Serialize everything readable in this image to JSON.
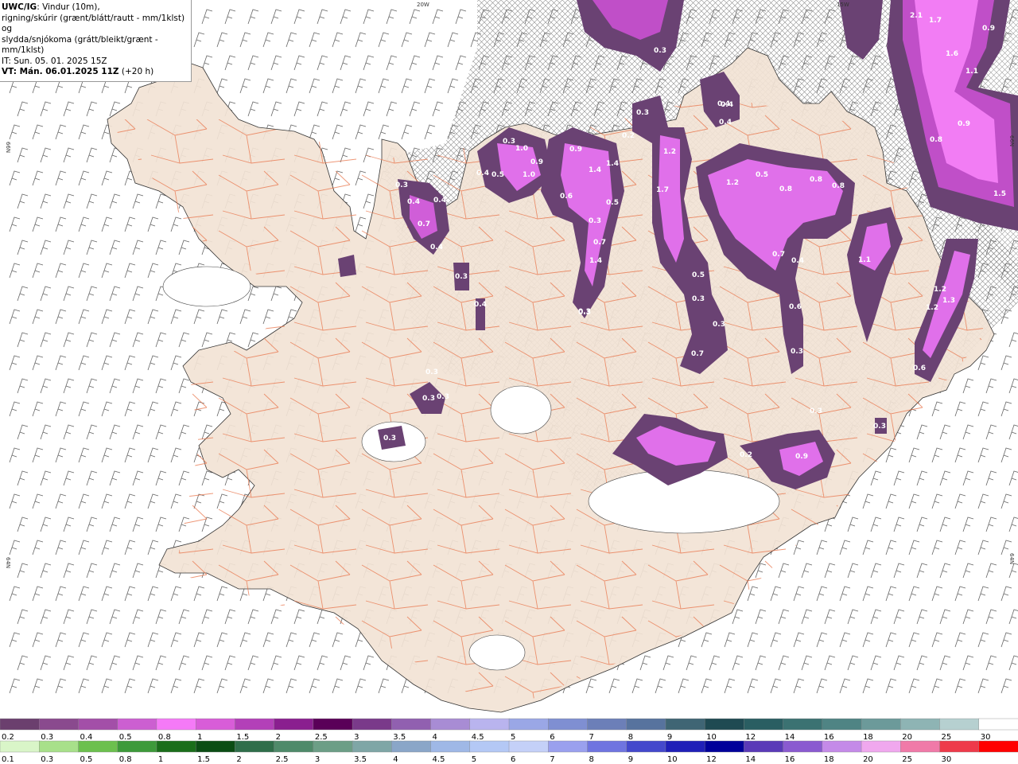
{
  "header": {
    "line1_bold": "UWC/IG",
    "line1_rest": ": Vindur (10m),",
    "line2": "rigning/skúrir (grænt/blátt/rautt - mm/1klst) og",
    "line3": "slydda/snjókoma (grátt/bleikt/grænt - mm/1klst)",
    "line4": "IT: Sun. 05. 01. 2025 15Z",
    "line5_bold": "VT: Mán. 06.01.2025 11Z",
    "line5_rest": " (+20 h)"
  },
  "grid_labels": [
    "20W",
    "15W",
    "66N",
    "66N",
    "64N",
    "64N"
  ],
  "map_labels": [
    "2.1",
    "1.7",
    "0.9",
    "1.6",
    "1.1",
    "0.9",
    "0.8",
    "1.5",
    "0.3",
    "0.3",
    "0.2",
    "0.4",
    "0.4",
    "1.0",
    "0.9",
    "1.0",
    "0.4",
    "0.5",
    "0.3",
    "0.3",
    "0.4",
    "0.4",
    "0.7",
    "0.4",
    "0.9",
    "1.4",
    "1.4",
    "0.5",
    "0.6",
    "0.3",
    "0.7",
    "1.4",
    "0.3",
    "1.2",
    "1.7",
    "0.4",
    "1.2",
    "0.5",
    "0.8",
    "0.8",
    "0.8",
    "0.7",
    "0.4",
    "1.1",
    "0.5",
    "0.3",
    "0.3",
    "0.6",
    "0.3",
    "1.2",
    "1.3",
    "1.2",
    "0.6",
    "0.7",
    "0.3",
    "0.3",
    "0.3",
    "0.3",
    "0.3",
    "0.4",
    "0.3",
    "0.3",
    "0.2",
    "0.9",
    "0.3"
  ],
  "colors": {
    "land": "#f2e3d5",
    "road": "#e8744a",
    "sea": "#ffffff",
    "snow_dark": "#6a4273",
    "snow_mid": "#9b4aa6",
    "snow_light": "#e060e8",
    "hatch": "#777777"
  },
  "legend": {
    "snow_scale": {
      "labels": [
        "0.2",
        "0.3",
        "0.4",
        "0.5",
        "0.8",
        "1",
        "1.5",
        "2",
        "2.5",
        "3",
        "3.5",
        "4",
        "4.5",
        "5",
        "6",
        "7",
        "8",
        "9",
        "10",
        "12",
        "14",
        "16",
        "18",
        "20",
        "25",
        "30"
      ],
      "colors": [
        "#6b3f6e",
        "#8a4a8e",
        "#a34fa8",
        "#cc5fd1",
        "#f57af7",
        "#d85dd8",
        "#b340b8",
        "#8a1f8f",
        "#5a0058",
        "#7a3a8a",
        "#9160b0",
        "#a88cd4",
        "#b9b4ee",
        "#9aa7e6",
        "#7f8fd2",
        "#6c7fb8",
        "#57739e",
        "#3f6574",
        "#1f4a52",
        "#2a5e62",
        "#3b7272",
        "#4f8484",
        "#6c9a9a",
        "#8eb4b4",
        "#b6d0d0",
        "#ffffff"
      ]
    },
    "rain_scale": {
      "labels": [
        "0.1",
        "0.3",
        "0.5",
        "0.8",
        "1",
        "1.5",
        "2",
        "2.5",
        "3",
        "3.5",
        "4",
        "4.5",
        "5",
        "6",
        "7",
        "8",
        "9",
        "10",
        "12",
        "14",
        "16",
        "18",
        "20",
        "25",
        "30"
      ],
      "colors": [
        "#d9f5c8",
        "#a8e08a",
        "#6cc04e",
        "#3d9a3a",
        "#1a6e1a",
        "#0b4d14",
        "#2f6e4a",
        "#4f8a6a",
        "#6c9e86",
        "#7fa6a6",
        "#8aa6c8",
        "#9fb8e6",
        "#b4c8f5",
        "#c4d0f8",
        "#9aa0ee",
        "#6f74e0",
        "#4448cc",
        "#1f1fb8",
        "#00009a",
        "#5a3ab8",
        "#8a5ad0",
        "#c48ae8",
        "#f0a8ee",
        "#f07aa8",
        "#ee3a4a",
        "#ff0000"
      ]
    }
  }
}
